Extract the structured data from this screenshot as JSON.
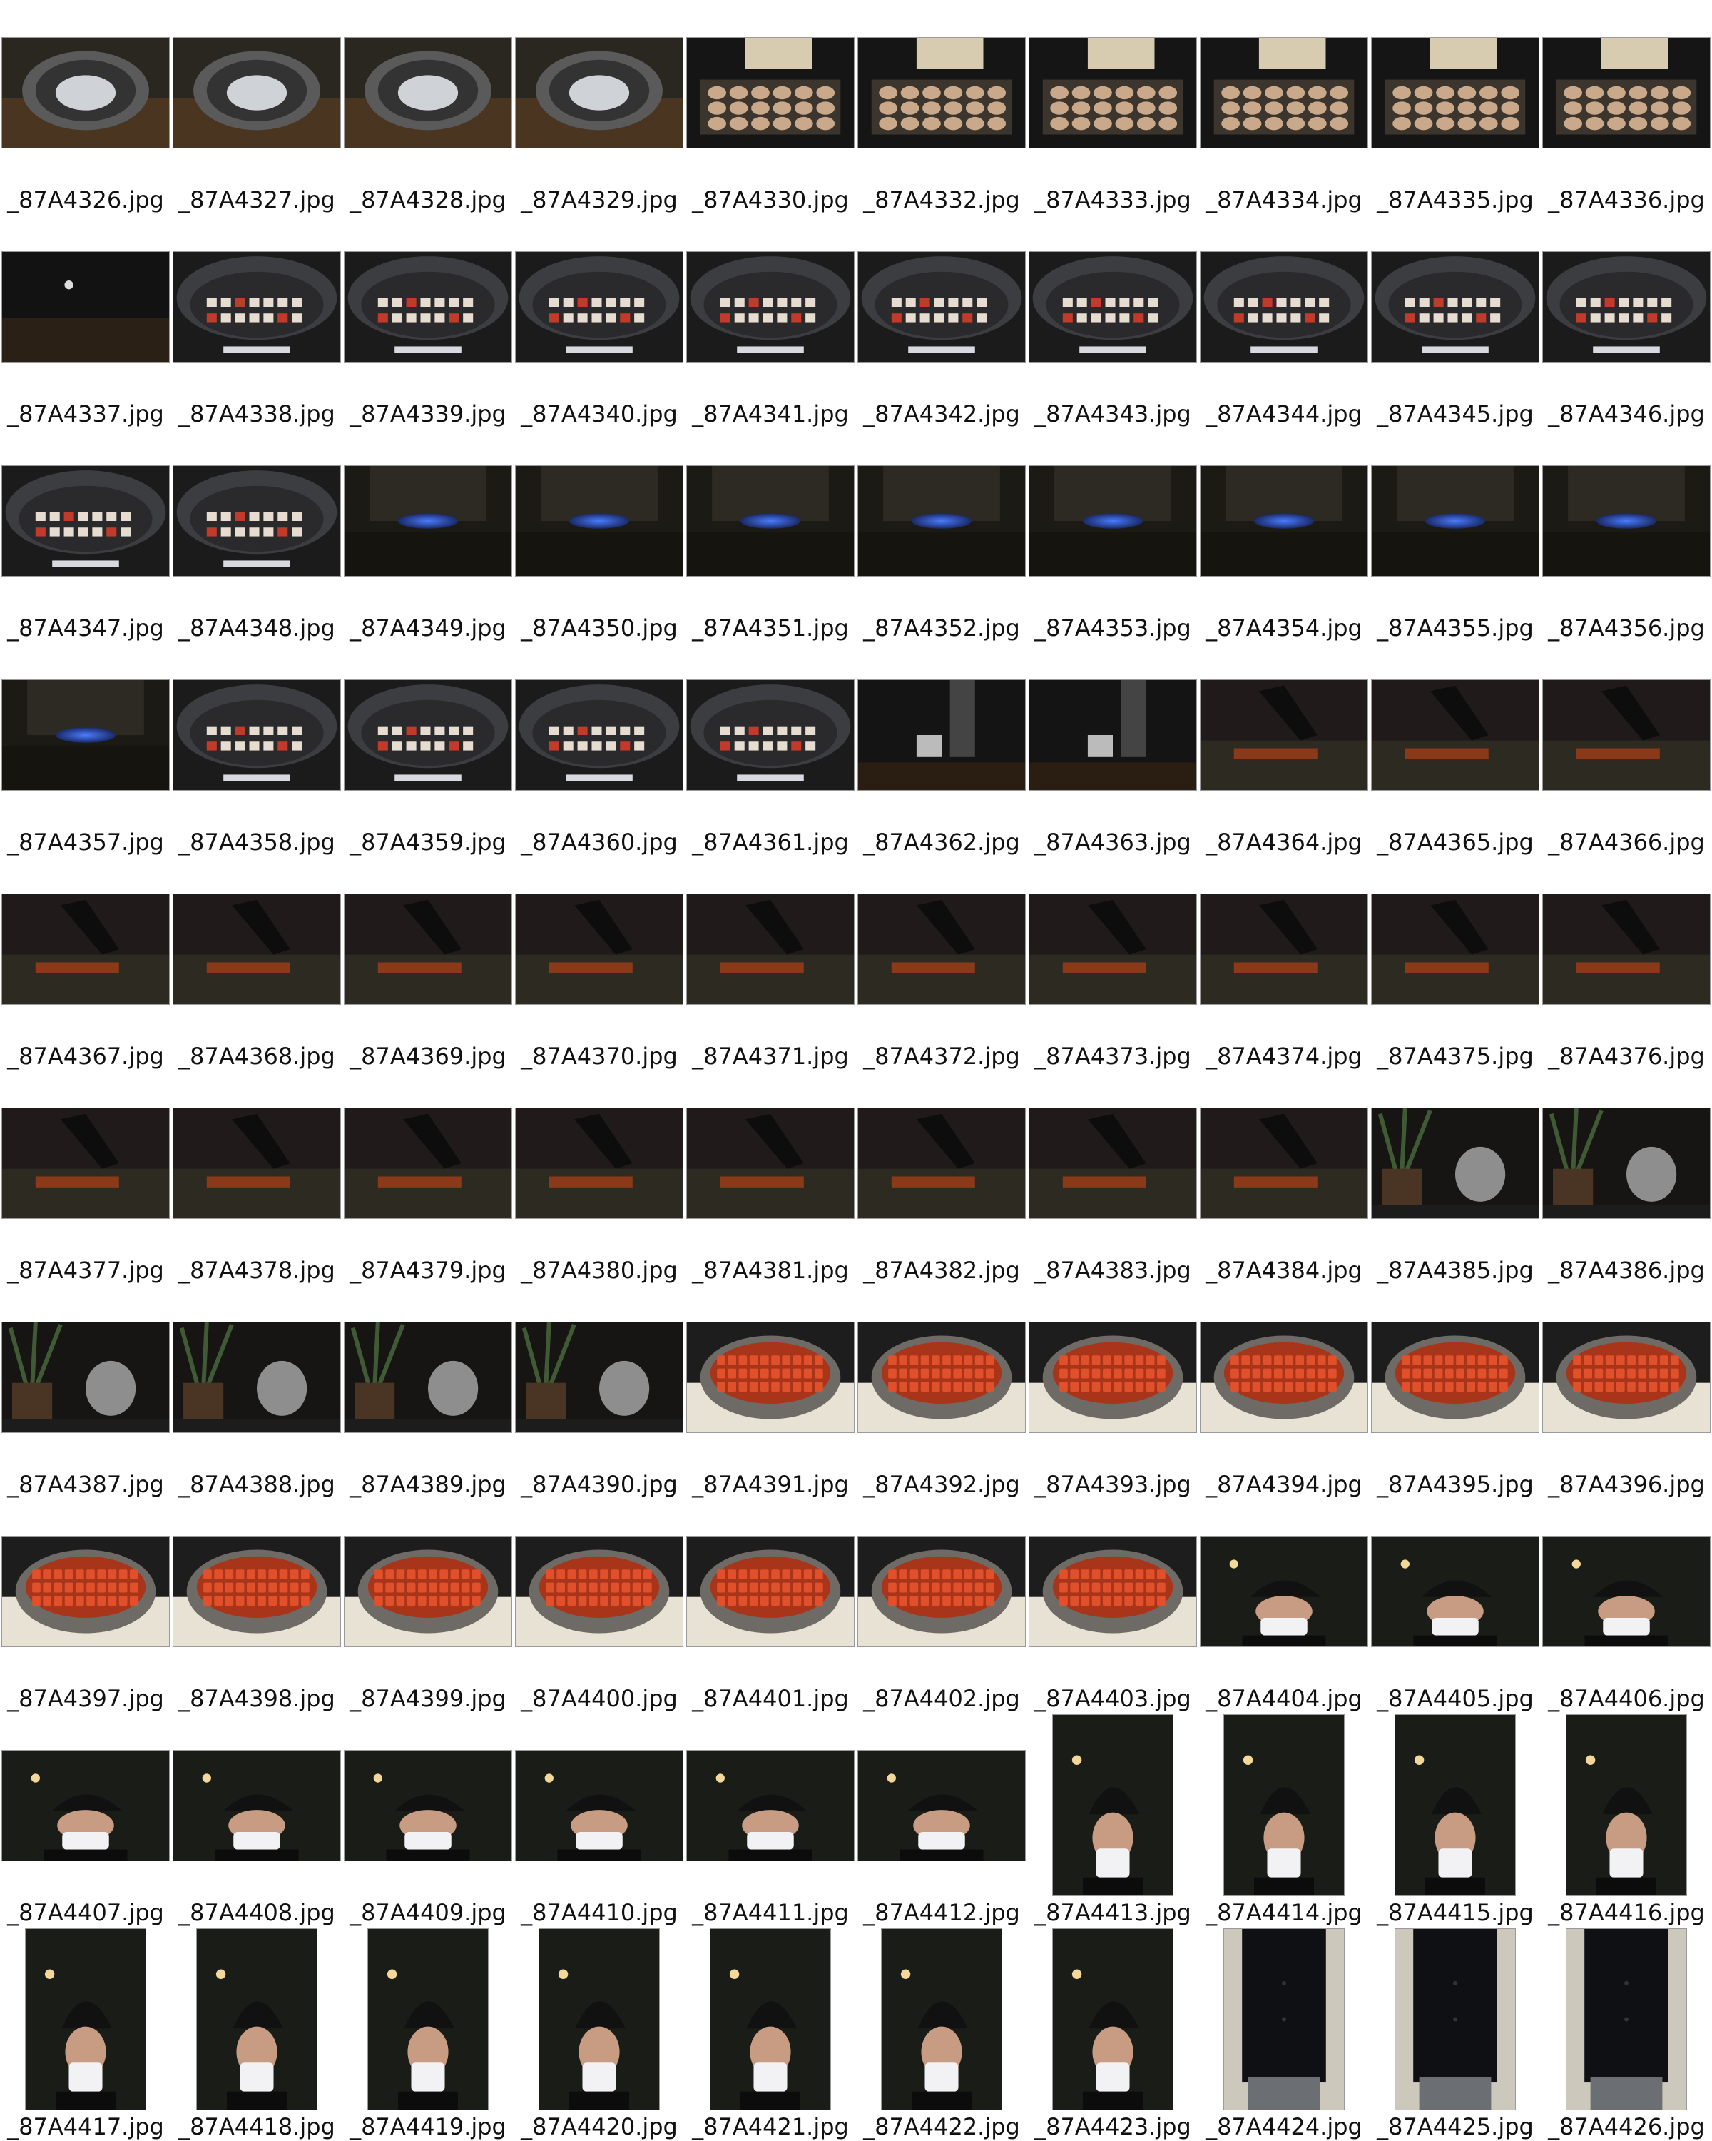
{
  "contact_sheet": {
    "rows": [
      {
        "items": [
          {
            "filename": "_87A4326.jpg",
            "thumb": "bowl-with-salt",
            "orientation": "landscape"
          },
          {
            "filename": "_87A4327.jpg",
            "thumb": "bowl-with-salt",
            "orientation": "landscape"
          },
          {
            "filename": "_87A4328.jpg",
            "thumb": "bowl-with-salt",
            "orientation": "landscape"
          },
          {
            "filename": "_87A4329.jpg",
            "thumb": "bowl-with-salt",
            "orientation": "landscape"
          },
          {
            "filename": "_87A4330.jpg",
            "thumb": "tray-of-mushrooms",
            "orientation": "landscape"
          },
          {
            "filename": "_87A4332.jpg",
            "thumb": "tray-of-mushrooms",
            "orientation": "landscape"
          },
          {
            "filename": "_87A4333.jpg",
            "thumb": "tray-of-mushrooms",
            "orientation": "landscape"
          },
          {
            "filename": "_87A4334.jpg",
            "thumb": "tray-of-mushrooms",
            "orientation": "landscape"
          },
          {
            "filename": "_87A4335.jpg",
            "thumb": "tray-of-mushrooms",
            "orientation": "landscape"
          },
          {
            "filename": "_87A4336.jpg",
            "thumb": "tray-of-mushrooms",
            "orientation": "landscape"
          }
        ]
      },
      {
        "items": [
          {
            "filename": "_87A4337.jpg",
            "thumb": "tray-dark",
            "orientation": "landscape"
          },
          {
            "filename": "_87A4338.jpg",
            "thumb": "pot-with-vegetables",
            "orientation": "landscape"
          },
          {
            "filename": "_87A4339.jpg",
            "thumb": "pot-with-vegetables",
            "orientation": "landscape"
          },
          {
            "filename": "_87A4340.jpg",
            "thumb": "pot-with-vegetables",
            "orientation": "landscape"
          },
          {
            "filename": "_87A4341.jpg",
            "thumb": "pot-with-vegetables",
            "orientation": "landscape"
          },
          {
            "filename": "_87A4342.jpg",
            "thumb": "pot-with-vegetables",
            "orientation": "landscape"
          },
          {
            "filename": "_87A4343.jpg",
            "thumb": "pot-with-vegetables",
            "orientation": "landscape"
          },
          {
            "filename": "_87A4344.jpg",
            "thumb": "pot-with-vegetables",
            "orientation": "landscape"
          },
          {
            "filename": "_87A4345.jpg",
            "thumb": "pot-with-vegetables",
            "orientation": "landscape"
          },
          {
            "filename": "_87A4346.jpg",
            "thumb": "pot-with-vegetables",
            "orientation": "landscape"
          }
        ]
      },
      {
        "items": [
          {
            "filename": "_87A4347.jpg",
            "thumb": "pot-with-vegetables",
            "orientation": "landscape"
          },
          {
            "filename": "_87A4348.jpg",
            "thumb": "pot-with-vegetables",
            "orientation": "landscape"
          },
          {
            "filename": "_87A4349.jpg",
            "thumb": "gas-burner-flame",
            "orientation": "landscape"
          },
          {
            "filename": "_87A4350.jpg",
            "thumb": "gas-burner-flame",
            "orientation": "landscape"
          },
          {
            "filename": "_87A4351.jpg",
            "thumb": "gas-burner-flame",
            "orientation": "landscape"
          },
          {
            "filename": "_87A4352.jpg",
            "thumb": "gas-burner-flame",
            "orientation": "landscape"
          },
          {
            "filename": "_87A4353.jpg",
            "thumb": "gas-burner-flame",
            "orientation": "landscape"
          },
          {
            "filename": "_87A4354.jpg",
            "thumb": "gas-burner-flame",
            "orientation": "landscape"
          },
          {
            "filename": "_87A4355.jpg",
            "thumb": "gas-burner-flame",
            "orientation": "landscape"
          },
          {
            "filename": "_87A4356.jpg",
            "thumb": "gas-burner-flame",
            "orientation": "landscape"
          }
        ]
      },
      {
        "items": [
          {
            "filename": "_87A4357.jpg",
            "thumb": "gas-burner-flame",
            "orientation": "landscape"
          },
          {
            "filename": "_87A4358.jpg",
            "thumb": "pot-with-vegetables",
            "orientation": "landscape"
          },
          {
            "filename": "_87A4359.jpg",
            "thumb": "pot-with-vegetables",
            "orientation": "landscape"
          },
          {
            "filename": "_87A4360.jpg",
            "thumb": "pot-with-vegetables",
            "orientation": "landscape"
          },
          {
            "filename": "_87A4361.jpg",
            "thumb": "pot-with-vegetables",
            "orientation": "landscape"
          },
          {
            "filename": "_87A4362.jpg",
            "thumb": "kitchen-dark",
            "orientation": "landscape"
          },
          {
            "filename": "_87A4363.jpg",
            "thumb": "kitchen-dark",
            "orientation": "landscape"
          },
          {
            "filename": "_87A4364.jpg",
            "thumb": "cutting-carrots",
            "orientation": "landscape"
          },
          {
            "filename": "_87A4365.jpg",
            "thumb": "cutting-carrots",
            "orientation": "landscape"
          },
          {
            "filename": "_87A4366.jpg",
            "thumb": "cutting-carrots",
            "orientation": "landscape"
          }
        ]
      },
      {
        "items": [
          {
            "filename": "_87A4367.jpg",
            "thumb": "cutting-carrots",
            "orientation": "landscape"
          },
          {
            "filename": "_87A4368.jpg",
            "thumb": "cutting-carrots",
            "orientation": "landscape"
          },
          {
            "filename": "_87A4369.jpg",
            "thumb": "cutting-carrots",
            "orientation": "landscape"
          },
          {
            "filename": "_87A4370.jpg",
            "thumb": "cutting-carrots",
            "orientation": "landscape"
          },
          {
            "filename": "_87A4371.jpg",
            "thumb": "cutting-carrots",
            "orientation": "landscape"
          },
          {
            "filename": "_87A4372.jpg",
            "thumb": "cutting-carrots",
            "orientation": "landscape"
          },
          {
            "filename": "_87A4373.jpg",
            "thumb": "cutting-carrots",
            "orientation": "landscape"
          },
          {
            "filename": "_87A4374.jpg",
            "thumb": "cutting-carrots",
            "orientation": "landscape"
          },
          {
            "filename": "_87A4375.jpg",
            "thumb": "cutting-carrots",
            "orientation": "landscape"
          },
          {
            "filename": "_87A4376.jpg",
            "thumb": "cutting-carrots",
            "orientation": "landscape"
          }
        ]
      },
      {
        "items": [
          {
            "filename": "_87A4377.jpg",
            "thumb": "cutting-carrots",
            "orientation": "landscape"
          },
          {
            "filename": "_87A4378.jpg",
            "thumb": "cutting-carrots",
            "orientation": "landscape"
          },
          {
            "filename": "_87A4379.jpg",
            "thumb": "cutting-carrots",
            "orientation": "landscape"
          },
          {
            "filename": "_87A4380.jpg",
            "thumb": "cutting-carrots",
            "orientation": "landscape"
          },
          {
            "filename": "_87A4381.jpg",
            "thumb": "cutting-carrots",
            "orientation": "landscape"
          },
          {
            "filename": "_87A4382.jpg",
            "thumb": "cutting-carrots",
            "orientation": "landscape"
          },
          {
            "filename": "_87A4383.jpg",
            "thumb": "cutting-carrots",
            "orientation": "landscape"
          },
          {
            "filename": "_87A4384.jpg",
            "thumb": "cutting-carrots",
            "orientation": "landscape"
          },
          {
            "filename": "_87A4385.jpg",
            "thumb": "plant-and-kettle",
            "orientation": "landscape"
          },
          {
            "filename": "_87A4386.jpg",
            "thumb": "plant-and-kettle",
            "orientation": "landscape"
          }
        ]
      },
      {
        "items": [
          {
            "filename": "_87A4387.jpg",
            "thumb": "plant-and-kettle",
            "orientation": "landscape"
          },
          {
            "filename": "_87A4388.jpg",
            "thumb": "plant-and-kettle",
            "orientation": "landscape"
          },
          {
            "filename": "_87A4389.jpg",
            "thumb": "plant-and-kettle",
            "orientation": "landscape"
          },
          {
            "filename": "_87A4390.jpg",
            "thumb": "plant-and-kettle",
            "orientation": "landscape"
          },
          {
            "filename": "_87A4391.jpg",
            "thumb": "pan-of-carrots",
            "orientation": "landscape"
          },
          {
            "filename": "_87A4392.jpg",
            "thumb": "pan-of-carrots",
            "orientation": "landscape"
          },
          {
            "filename": "_87A4393.jpg",
            "thumb": "pan-of-carrots",
            "orientation": "landscape"
          },
          {
            "filename": "_87A4394.jpg",
            "thumb": "pan-of-carrots",
            "orientation": "landscape"
          },
          {
            "filename": "_87A4395.jpg",
            "thumb": "pan-of-carrots",
            "orientation": "landscape"
          },
          {
            "filename": "_87A4396.jpg",
            "thumb": "pan-of-carrots",
            "orientation": "landscape"
          }
        ]
      },
      {
        "items": [
          {
            "filename": "_87A4397.jpg",
            "thumb": "pan-of-carrots",
            "orientation": "landscape"
          },
          {
            "filename": "_87A4398.jpg",
            "thumb": "pan-of-carrots",
            "orientation": "landscape"
          },
          {
            "filename": "_87A4399.jpg",
            "thumb": "pan-of-carrots",
            "orientation": "landscape"
          },
          {
            "filename": "_87A4400.jpg",
            "thumb": "pan-of-carrots",
            "orientation": "landscape"
          },
          {
            "filename": "_87A4401.jpg",
            "thumb": "pan-of-carrots",
            "orientation": "landscape"
          },
          {
            "filename": "_87A4402.jpg",
            "thumb": "pan-of-carrots",
            "orientation": "landscape"
          },
          {
            "filename": "_87A4403.jpg",
            "thumb": "pan-of-carrots",
            "orientation": "landscape"
          },
          {
            "filename": "_87A4404.jpg",
            "thumb": "chef-portrait",
            "orientation": "landscape"
          },
          {
            "filename": "_87A4405.jpg",
            "thumb": "chef-portrait",
            "orientation": "landscape"
          },
          {
            "filename": "_87A4406.jpg",
            "thumb": "chef-portrait",
            "orientation": "landscape"
          }
        ]
      },
      {
        "items": [
          {
            "filename": "_87A4407.jpg",
            "thumb": "chef-portrait",
            "orientation": "landscape"
          },
          {
            "filename": "_87A4408.jpg",
            "thumb": "chef-portrait",
            "orientation": "landscape"
          },
          {
            "filename": "_87A4409.jpg",
            "thumb": "chef-portrait",
            "orientation": "landscape"
          },
          {
            "filename": "_87A4410.jpg",
            "thumb": "chef-portrait",
            "orientation": "landscape"
          },
          {
            "filename": "_87A4411.jpg",
            "thumb": "chef-portrait",
            "orientation": "landscape"
          },
          {
            "filename": "_87A4412.jpg",
            "thumb": "chef-portrait",
            "orientation": "landscape"
          },
          {
            "filename": "_87A4413.jpg",
            "thumb": "chef-portrait",
            "orientation": "portrait"
          },
          {
            "filename": "_87A4414.jpg",
            "thumb": "chef-portrait",
            "orientation": "portrait"
          },
          {
            "filename": "_87A4415.jpg",
            "thumb": "chef-portrait",
            "orientation": "portrait"
          },
          {
            "filename": "_87A4416.jpg",
            "thumb": "chef-portrait",
            "orientation": "portrait"
          }
        ]
      },
      {
        "items": [
          {
            "filename": "_87A4417.jpg",
            "thumb": "chef-portrait",
            "orientation": "portrait"
          },
          {
            "filename": "_87A4418.jpg",
            "thumb": "chef-portrait",
            "orientation": "portrait"
          },
          {
            "filename": "_87A4419.jpg",
            "thumb": "chef-portrait",
            "orientation": "portrait"
          },
          {
            "filename": "_87A4420.jpg",
            "thumb": "chef-portrait",
            "orientation": "portrait"
          },
          {
            "filename": "_87A4421.jpg",
            "thumb": "chef-portrait",
            "orientation": "portrait"
          },
          {
            "filename": "_87A4422.jpg",
            "thumb": "chef-portrait",
            "orientation": "portrait"
          },
          {
            "filename": "_87A4423.jpg",
            "thumb": "chef-portrait",
            "orientation": "portrait"
          },
          {
            "filename": "_87A4424.jpg",
            "thumb": "chef-torso",
            "orientation": "portrait"
          },
          {
            "filename": "_87A4425.jpg",
            "thumb": "chef-torso",
            "orientation": "portrait"
          },
          {
            "filename": "_87A4426.jpg",
            "thumb": "chef-torso",
            "orientation": "portrait"
          }
        ]
      }
    ]
  }
}
